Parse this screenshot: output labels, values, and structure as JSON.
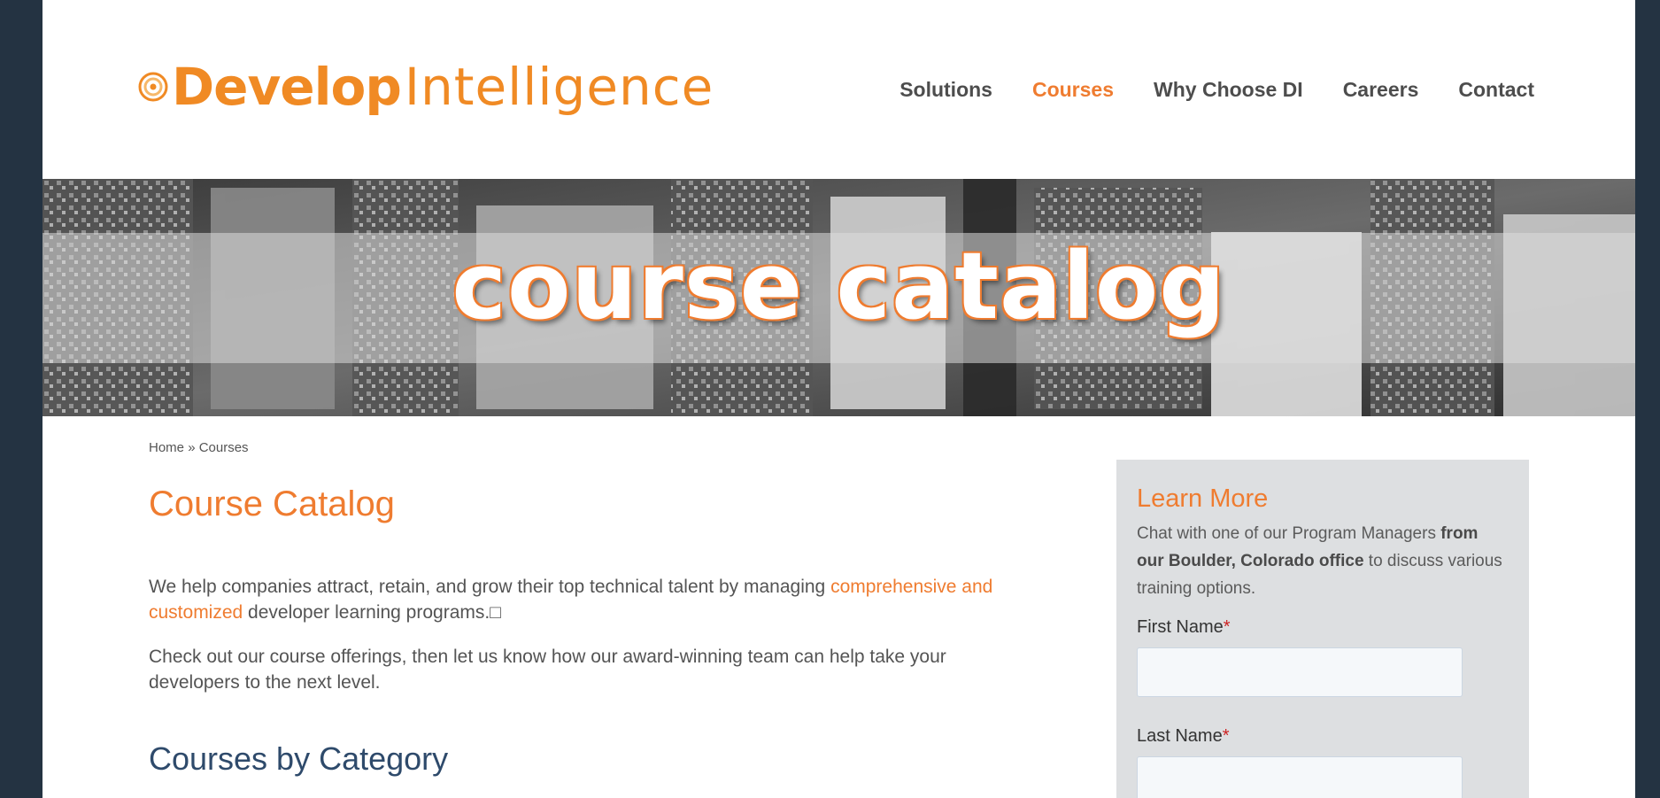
{
  "logo": {
    "bold": "Develop",
    "light": "Intelligence"
  },
  "nav": {
    "items": [
      {
        "label": "Solutions"
      },
      {
        "label": "Courses"
      },
      {
        "label": "Why Choose DI"
      },
      {
        "label": "Careers"
      },
      {
        "label": "Contact"
      }
    ],
    "active": "Courses"
  },
  "banner": {
    "title": "course catalog"
  },
  "breadcrumb": {
    "home": "Home",
    "separator": "»",
    "current": "Courses"
  },
  "main": {
    "title": "Course Catalog",
    "intro": {
      "before": "We help companies attract, retain, and grow their top technical talent by managing ",
      "link": "comprehensive and customized",
      "after": " developer learning programs.",
      "glyph": "□"
    },
    "para2": "Check out our course offerings, then let us know how our award-winning team can help take your developers to the next level.",
    "section_title": "Courses by Category"
  },
  "sidebar": {
    "title": "Learn More",
    "text_before": "Chat with one of our Program Managers ",
    "text_bold": "from our Boulder, Colorado office",
    "text_after": " to discuss various training options.",
    "fields": [
      {
        "label": "First Name",
        "required_mark": "*",
        "value": ""
      },
      {
        "label": "Last Name",
        "required_mark": "*",
        "value": ""
      }
    ]
  },
  "colors": {
    "accent": "#ef7c30",
    "navy": "#2e4a6b",
    "frame": "#243342",
    "sidebar_bg": "#dddfe1"
  }
}
